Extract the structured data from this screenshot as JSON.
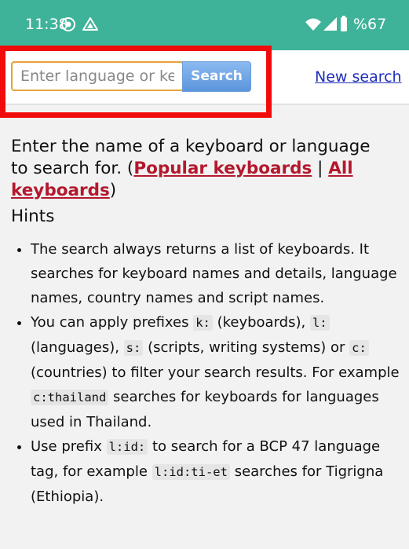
{
  "status_bar": {
    "time": "11:38",
    "battery_percent": "%67",
    "icons": [
      "record-icon",
      "drive-icon",
      "wifi-icon",
      "signal-icon",
      "battery-icon"
    ],
    "background_color": "#3fb39a"
  },
  "search": {
    "placeholder": "Enter language or keybo",
    "button_label": "Search",
    "new_search_label": "New search",
    "highlight_color": "#f20b0b"
  },
  "intro": {
    "text_before": "Enter the name of a keyboard or language to search for. (",
    "popular_link": "Popular keyboards",
    "separator": " | ",
    "all_link": "All keyboards",
    "text_after": ")"
  },
  "hints": {
    "title": "Hints",
    "item1": "The search always returns a list of keyboards. It searches for keyboard names and details, language names, country names and script names.",
    "item2": {
      "t1": "You can apply prefixes ",
      "c1": "k:",
      "t2": " (keyboards), ",
      "c2": "l:",
      "t3": " (languages), ",
      "c3": "s:",
      "t4": " (scripts, writing systems) or ",
      "c4": "c:",
      "t5": " (countries) to filter your search results. For example ",
      "c5": "c:thailand",
      "t6": " searches for keyboards for languages used in Thailand."
    },
    "item3": {
      "t1": "Use prefix ",
      "c1": "l:id:",
      "t2": " to search for a BCP 47 language tag, for example ",
      "c2": "l:id:ti-et",
      "t3": " searches for Tigrigna (Ethiopia)."
    }
  }
}
